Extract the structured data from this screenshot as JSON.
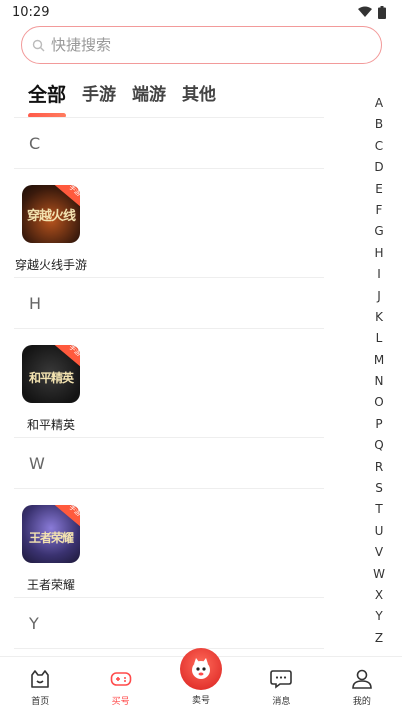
{
  "status": {
    "time": "10:29"
  },
  "search": {
    "placeholder": "快捷搜索"
  },
  "tabs": [
    {
      "label": "全部",
      "active": true
    },
    {
      "label": "手游",
      "active": false
    },
    {
      "label": "端游",
      "active": false
    },
    {
      "label": "其他",
      "active": false
    }
  ],
  "sections": [
    {
      "letter": "C",
      "game": {
        "name": "穿越火线手游",
        "icon_text": "穿越火线",
        "badge": "手游"
      }
    },
    {
      "letter": "H",
      "game": {
        "name": "和平精英",
        "icon_text": "和平精英",
        "badge": "手游"
      }
    },
    {
      "letter": "W",
      "game": {
        "name": "王者荣耀",
        "icon_text": "王者荣耀",
        "badge": "手游"
      }
    },
    {
      "letter": "Y"
    }
  ],
  "alphabet": [
    "A",
    "B",
    "C",
    "D",
    "E",
    "F",
    "G",
    "H",
    "I",
    "J",
    "K",
    "L",
    "M",
    "N",
    "O",
    "P",
    "Q",
    "R",
    "S",
    "T",
    "U",
    "V",
    "W",
    "X",
    "Y",
    "Z"
  ],
  "nav": [
    {
      "label": "首页",
      "icon": "home-icon"
    },
    {
      "label": "买号",
      "icon": "gamepad-icon",
      "active": true
    },
    {
      "label": "卖号",
      "icon": "sell-mascot-icon"
    },
    {
      "label": "消息",
      "icon": "message-icon"
    },
    {
      "label": "我的",
      "icon": "profile-icon"
    }
  ],
  "colors": {
    "accent": "#ff4a4a",
    "search_border": "#f29a9a",
    "badge": "#ff5a3d"
  }
}
